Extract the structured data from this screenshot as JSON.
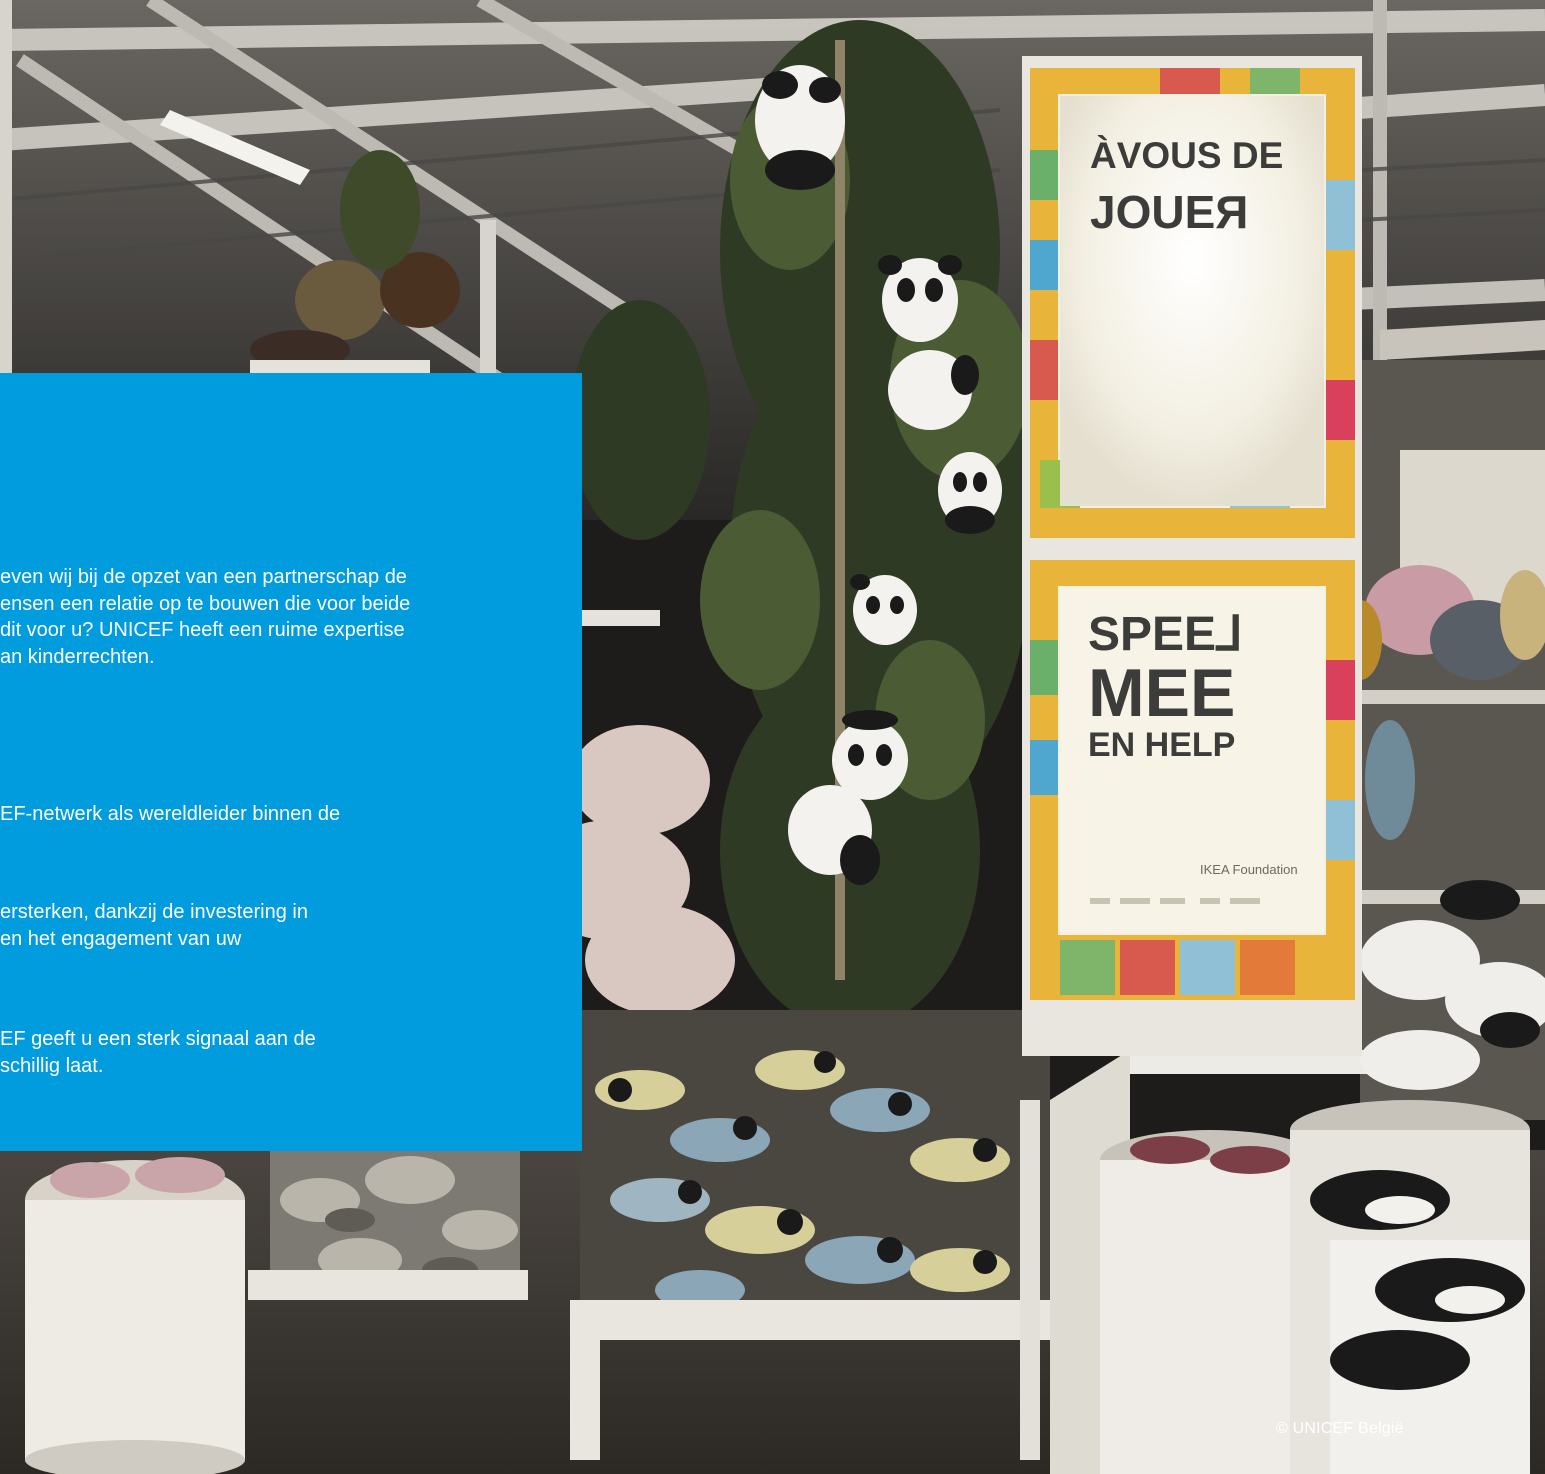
{
  "panel": {
    "color": "#009cde",
    "paragraph_1": [
      "even wij bij de opzet van een partnerschap de",
      "ensen een relatie op te bouwen die voor beide",
      "dit voor u? UNICEF heeft een ruime expertise",
      "an kinderrechten."
    ],
    "paragraph_2": [
      "EF-netwerk als wereldleider binnen de"
    ],
    "paragraph_3": [
      "ersterken, dankzij de investering in",
      "en het engagement van uw"
    ],
    "paragraph_4": [
      "EF geeft u een sterk signaal aan de",
      "schillig laat."
    ]
  },
  "photo": {
    "sign_top": {
      "line_1": "ÀVOUS DE",
      "line_2": "JOUEЯ"
    },
    "sign_bottom": {
      "line_1": "SPEE⅃",
      "line_2": "MEE",
      "line_3": "EN HELP",
      "sponsor": "IKEA Foundation"
    }
  },
  "credit": "© UNICEF België"
}
